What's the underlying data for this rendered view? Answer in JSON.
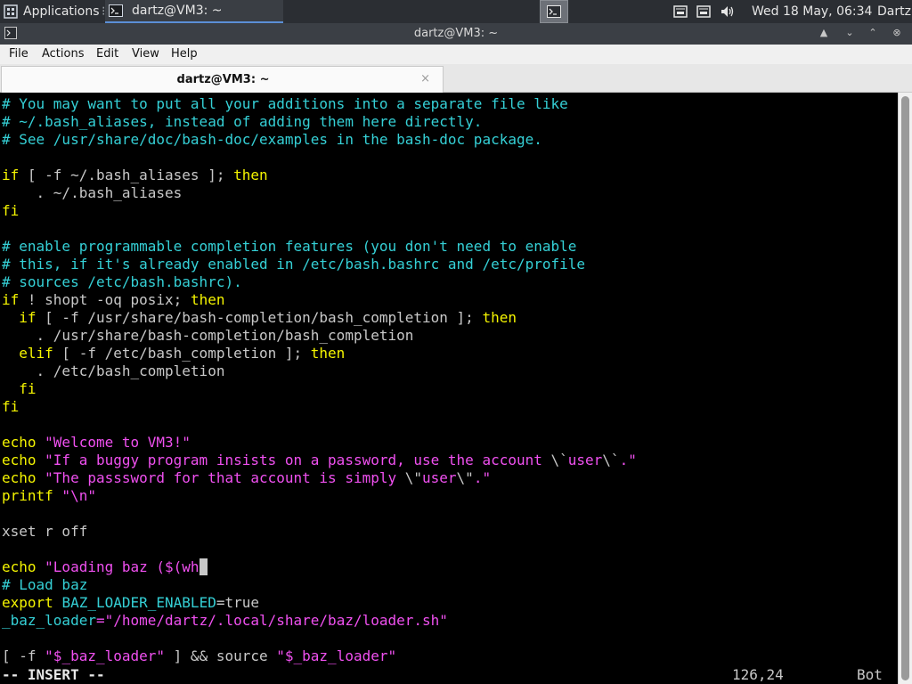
{
  "panel": {
    "applications": "Applications",
    "separator": "⁝",
    "task_title": "dartz@VM3: ~",
    "clock": "Wed 18 May, 06:34",
    "user": "Dartz"
  },
  "window": {
    "title": "dartz@VM3: ~",
    "btn_up": "▲",
    "btn_min": "⌄",
    "btn_max": "⌃",
    "btn_close": "⊗"
  },
  "menu": {
    "file": "File",
    "actions": "Actions",
    "edit": "Edit",
    "view": "View",
    "help": "Help"
  },
  "tab": {
    "label": "dartz@VM3: ~",
    "close": "×"
  },
  "editor": {
    "lines": [
      [
        {
          "t": "# You may want to put all your additions into a separate file like",
          "c": "cyan"
        }
      ],
      [
        {
          "t": "# ~/.bash_aliases, instead of adding them here directly.",
          "c": "cyan"
        }
      ],
      [
        {
          "t": "# See /usr/share/doc/bash-doc/examples in the bash-doc package.",
          "c": "cyan"
        }
      ],
      [],
      [
        {
          "t": "if",
          "c": "yel"
        },
        {
          "t": " [ -f ~/.bash_aliases ]; ",
          "c": "gry"
        },
        {
          "t": "then",
          "c": "yel"
        }
      ],
      [
        {
          "t": "    . ~/.bash_aliases",
          "c": "gry"
        }
      ],
      [
        {
          "t": "fi",
          "c": "yel"
        }
      ],
      [],
      [
        {
          "t": "# enable programmable completion features (you don't need to enable",
          "c": "cyan"
        }
      ],
      [
        {
          "t": "# this, if it's already enabled in /etc/bash.bashrc and /etc/profile",
          "c": "cyan"
        }
      ],
      [
        {
          "t": "# sources /etc/bash.bashrc).",
          "c": "cyan"
        }
      ],
      [
        {
          "t": "if",
          "c": "yel"
        },
        {
          "t": " ! ",
          "c": "gry"
        },
        {
          "t": "shopt",
          "c": "gry"
        },
        {
          "t": " -oq posix; ",
          "c": "gry"
        },
        {
          "t": "then",
          "c": "yel"
        }
      ],
      [
        {
          "t": "  ",
          "c": "gry"
        },
        {
          "t": "if",
          "c": "yel"
        },
        {
          "t": " [ -f /usr/share/bash-completion/bash_completion ]; ",
          "c": "gry"
        },
        {
          "t": "then",
          "c": "yel"
        }
      ],
      [
        {
          "t": "    . /usr/share/bash-completion/bash_completion",
          "c": "gry"
        }
      ],
      [
        {
          "t": "  ",
          "c": "gry"
        },
        {
          "t": "elif",
          "c": "yel"
        },
        {
          "t": " [ -f /etc/bash_completion ]; ",
          "c": "gry"
        },
        {
          "t": "then",
          "c": "yel"
        }
      ],
      [
        {
          "t": "    . /etc/bash_completion",
          "c": "gry"
        }
      ],
      [
        {
          "t": "  ",
          "c": "gry"
        },
        {
          "t": "fi",
          "c": "yel"
        }
      ],
      [
        {
          "t": "fi",
          "c": "yel"
        }
      ],
      [],
      [
        {
          "t": "echo",
          "c": "yel"
        },
        {
          "t": " \"Welcome to VM3!\"",
          "c": "mag"
        }
      ],
      [
        {
          "t": "echo",
          "c": "yel"
        },
        {
          "t": " \"If a buggy program insists on a password, use the account ",
          "c": "mag"
        },
        {
          "t": "\\`",
          "c": "gry"
        },
        {
          "t": "user",
          "c": "mag"
        },
        {
          "t": "\\`",
          "c": "gry"
        },
        {
          "t": ".\"",
          "c": "mag"
        }
      ],
      [
        {
          "t": "echo",
          "c": "yel"
        },
        {
          "t": " \"The passsword for that account is simply ",
          "c": "mag"
        },
        {
          "t": "\\\"",
          "c": "gry"
        },
        {
          "t": "user",
          "c": "mag"
        },
        {
          "t": "\\\"",
          "c": "gry"
        },
        {
          "t": ".\"",
          "c": "mag"
        }
      ],
      [
        {
          "t": "printf",
          "c": "yel"
        },
        {
          "t": " \"\\n\"",
          "c": "mag"
        }
      ],
      [],
      [
        {
          "t": "xset r off",
          "c": "gry"
        }
      ],
      [],
      [
        {
          "t": "echo",
          "c": "yel"
        },
        {
          "t": " \"Loading baz ($(wh",
          "c": "mag"
        },
        {
          "t": " ",
          "c": "cur"
        }
      ],
      [
        {
          "t": "# Load baz",
          "c": "cyan"
        }
      ],
      [
        {
          "t": "export",
          "c": "yel"
        },
        {
          "t": " ",
          "c": "gry"
        },
        {
          "t": "BAZ_LOADER_ENABLED",
          "c": "cyan"
        },
        {
          "t": "=true",
          "c": "gry"
        }
      ],
      [
        {
          "t": "_baz_loader",
          "c": "cyan"
        },
        {
          "t": "=\"/home/dartz/.local/share/baz/loader.sh\"",
          "c": "mag"
        }
      ],
      [],
      [
        {
          "t": "[ -f ",
          "c": "gry"
        },
        {
          "t": "\"$_baz_loader\"",
          "c": "mag"
        },
        {
          "t": " ] && ",
          "c": "gry"
        },
        {
          "t": "source",
          "c": "gry"
        },
        {
          "t": " \"$_baz_loader\"",
          "c": "mag"
        }
      ]
    ],
    "mode": "-- INSERT --",
    "position": "126,24",
    "scroll": "Bot"
  }
}
